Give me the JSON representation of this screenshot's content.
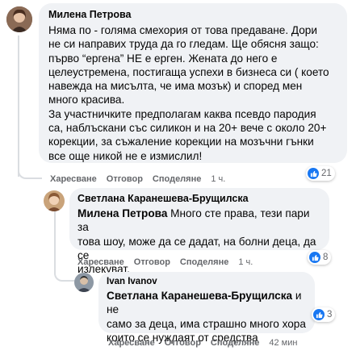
{
  "colors": {
    "accent": "#1877f2",
    "bubble": "#f0f2f5",
    "meta": "#65676b"
  },
  "comments": [
    {
      "author": "Милена Петрова",
      "text": "Няма по - голяма смехория от това предаване. Дори\nне си направих труда да го гледам. Ще обясня защо:\nпърво “ергена” НЕ е ерген. Жената до него е\nцелеустремена, постигаща успехи в бизнеса си ( което\nнавежда на мисълта, че има мозък) и според мен\nмного красива.\nЗа участничките предполагам каква псевдо пародия\nса, наблъскани със силикон и на 20+ вече с около 20+\nкорекции, за съжаление корекции на мозъчни гънки\nвсе още никой не е измислил!",
      "actions": {
        "like": "Харесване",
        "reply": "Отговор",
        "share": "Споделяне",
        "time": "1 ч."
      },
      "reactions": "21",
      "reaction_icon": "like-icon"
    },
    {
      "author": "Светлана Каранешева-Брущилска",
      "mention": "Милена Петрова",
      "text": " Много сте права, тези пари за\nтова шоу, може да се дадат, на болни деца, да се\nизлекуват.",
      "actions": {
        "like": "Харесване",
        "reply": "Отговор",
        "share": "Споделяне",
        "time": "1 ч."
      },
      "reactions": "8",
      "reaction_icon": "like-icon"
    },
    {
      "author": "Ivan Ivanov",
      "mention": "Светлана Каранешева-Брущилска",
      "text": " и не\nсамо за деца, има страшно много хора\nкоито се нуждаят от средства",
      "actions": {
        "like": "Харесване",
        "reply": "Отговор",
        "share": "Споделяне",
        "time": "42 мин"
      },
      "reactions": "3",
      "reaction_icon": "like-icon"
    }
  ]
}
